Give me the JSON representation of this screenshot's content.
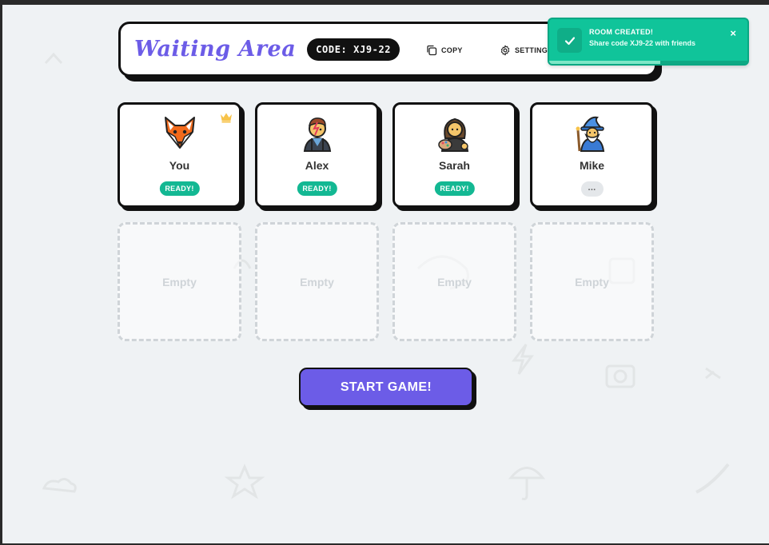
{
  "header": {
    "title": "Waiting Area",
    "code_label": "CODE: XJ9-22",
    "copy_label": "COPY",
    "settings_label": "SETTINGS"
  },
  "toast": {
    "title": "ROOM CREATED!",
    "message": "Share code XJ9-22 with friends",
    "close_icon": "×",
    "progress": 0.56
  },
  "players": [
    {
      "name": "You",
      "status": "READY!",
      "avatar": "fox-icon",
      "host": true
    },
    {
      "name": "Alex",
      "status": "READY!",
      "avatar": "singer-icon",
      "host": false
    },
    {
      "name": "Sarah",
      "status": "READY!",
      "avatar": "artist-icon",
      "host": false
    },
    {
      "name": "Mike",
      "status": "...",
      "avatar": "wizard-icon",
      "host": false
    }
  ],
  "empty_slots": [
    "Empty",
    "Empty",
    "Empty",
    "Empty"
  ],
  "start_button": "START GAME!",
  "colors": {
    "accent": "#6c5ce7",
    "ready": "#13b893",
    "toast": "#10c49a",
    "background": "#eff2f4"
  }
}
